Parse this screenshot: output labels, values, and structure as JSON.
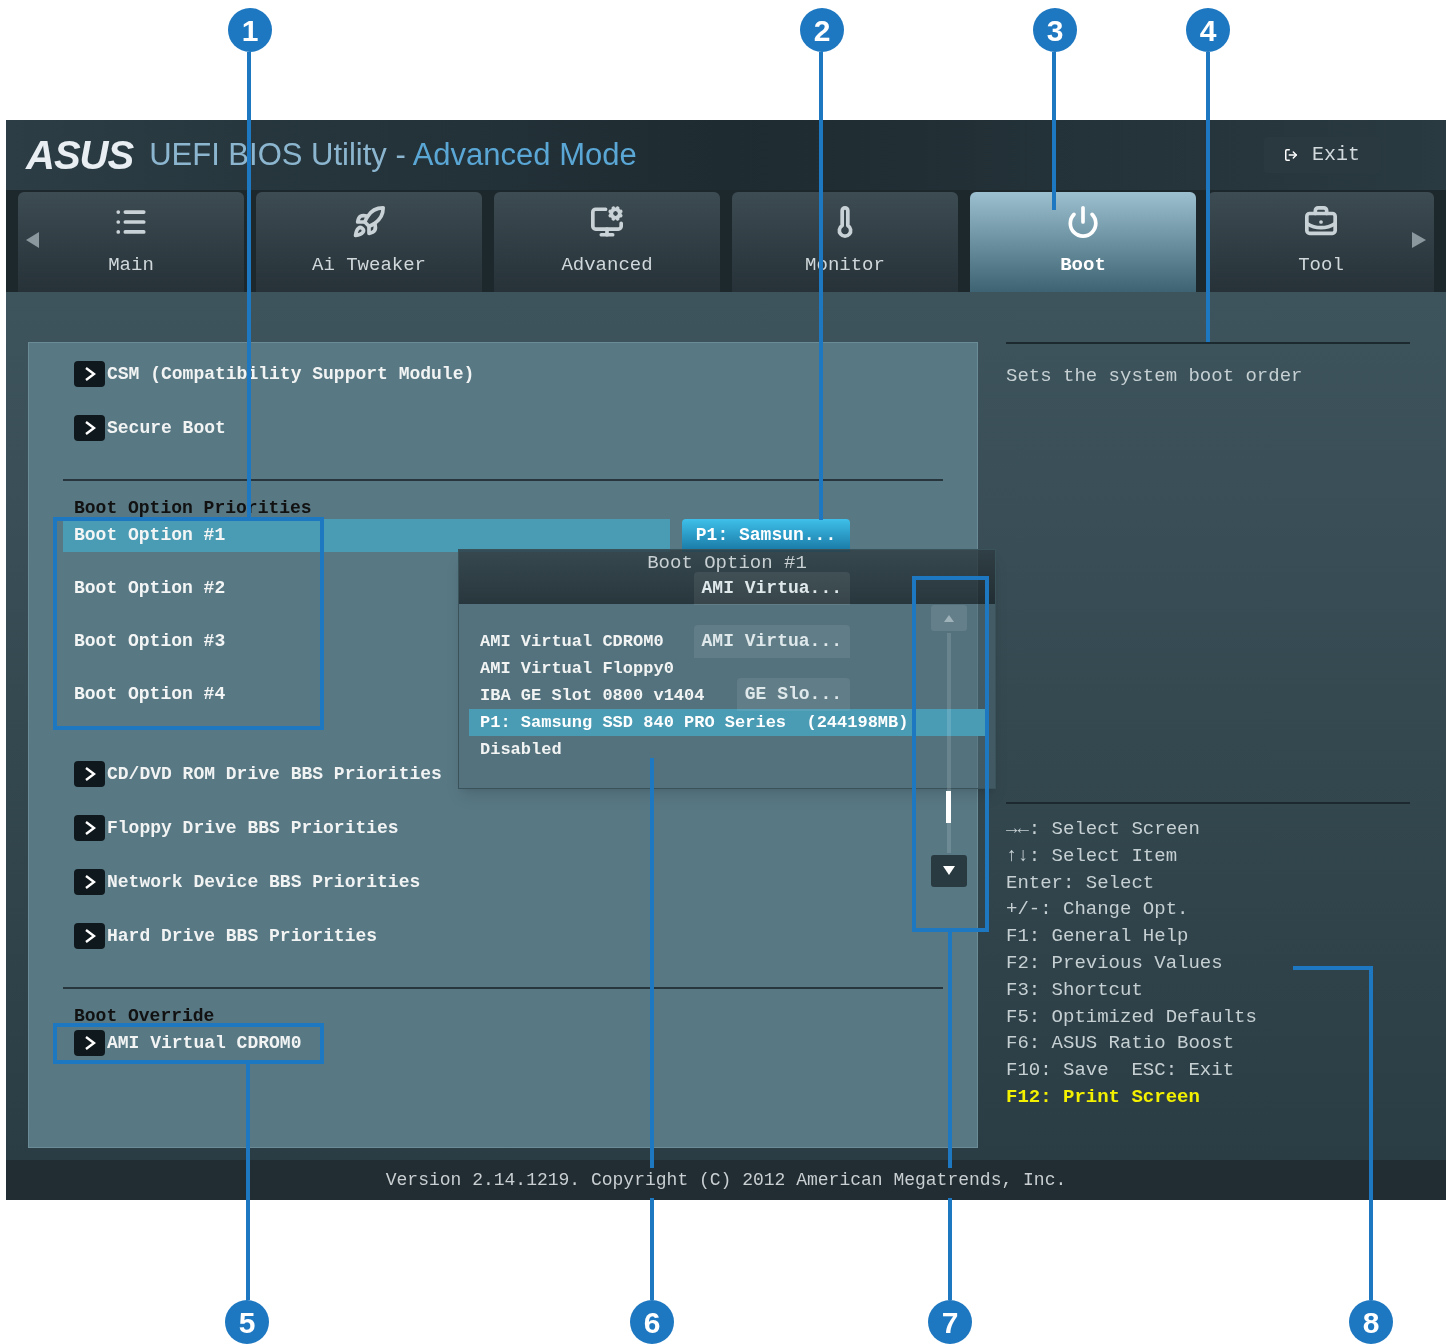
{
  "header": {
    "logo": "ASUS",
    "title": "UEFI BIOS Utility - ",
    "mode": "Advanced Mode",
    "exit": "Exit"
  },
  "tabs": [
    {
      "label": "Main",
      "selected": false
    },
    {
      "label": "Ai Tweaker",
      "selected": false
    },
    {
      "label": "Advanced",
      "selected": false
    },
    {
      "label": "Monitor",
      "selected": false
    },
    {
      "label": "Boot",
      "selected": true
    },
    {
      "label": "Tool",
      "selected": false
    }
  ],
  "main_panel": {
    "items": [
      {
        "kind": "submenu",
        "label": "CSM (Compatibility Support Module)"
      },
      {
        "kind": "submenu",
        "label": "Secure Boot"
      },
      {
        "kind": "divider"
      },
      {
        "kind": "heading",
        "label": "Boot Option Priorities"
      },
      {
        "kind": "option",
        "label": "Boot Option #1",
        "value": "P1: Samsun...",
        "selected": true
      },
      {
        "kind": "option",
        "label": "Boot Option #2",
        "value": "AMI Virtua...",
        "selected": false
      },
      {
        "kind": "option",
        "label": "Boot Option #3",
        "value": "AMI Virtua...",
        "selected": false
      },
      {
        "kind": "option",
        "label": "Boot Option #4",
        "value": "GE Slo...",
        "selected": false
      },
      {
        "kind": "submenu",
        "label": "CD/DVD ROM Drive BBS Priorities"
      },
      {
        "kind": "submenu",
        "label": "Floppy Drive BBS Priorities"
      },
      {
        "kind": "submenu",
        "label": "Network Device BBS Priorities"
      },
      {
        "kind": "submenu",
        "label": "Hard Drive BBS Priorities"
      },
      {
        "kind": "divider"
      },
      {
        "kind": "heading",
        "label": "Boot Override"
      },
      {
        "kind": "submenu",
        "label": "AMI Virtual CDROM0"
      }
    ]
  },
  "popup": {
    "title": "Boot Option #1",
    "options": [
      {
        "label": "AMI Virtual CDROM0",
        "selected": false
      },
      {
        "label": "AMI Virtual Floppy0",
        "selected": false
      },
      {
        "label": "IBA GE Slot 0800 v1404",
        "selected": false
      },
      {
        "label": "P1: Samsung SSD 840 PRO Series  (244198MB)",
        "selected": true
      },
      {
        "label": "Disabled",
        "selected": false
      }
    ]
  },
  "help": {
    "description": "Sets the system boot order",
    "keys": [
      {
        "text": "→←: Select Screen",
        "highlighted": false
      },
      {
        "text": "↑↓: Select Item",
        "highlighted": false
      },
      {
        "text": "Enter: Select",
        "highlighted": false
      },
      {
        "text": "+/-: Change Opt.",
        "highlighted": false
      },
      {
        "text": "F1: General Help",
        "highlighted": false
      },
      {
        "text": "F2: Previous Values",
        "highlighted": false
      },
      {
        "text": "F3: Shortcut",
        "highlighted": false
      },
      {
        "text": "F5: Optimized Defaults",
        "highlighted": false
      },
      {
        "text": "F6: ASUS Ratio Boost",
        "highlighted": false
      },
      {
        "text": "F10: Save  ESC: Exit",
        "highlighted": false
      },
      {
        "text": "F12: Print Screen",
        "highlighted": true
      }
    ]
  },
  "status_bar": "Version 2.14.1219. Copyright (C) 2012 American Megatrends, Inc.",
  "callouts": [
    {
      "label": "1"
    },
    {
      "label": "2"
    },
    {
      "label": "3"
    },
    {
      "label": "4"
    },
    {
      "label": "5"
    },
    {
      "label": "6"
    },
    {
      "label": "7"
    },
    {
      "label": "8"
    }
  ]
}
